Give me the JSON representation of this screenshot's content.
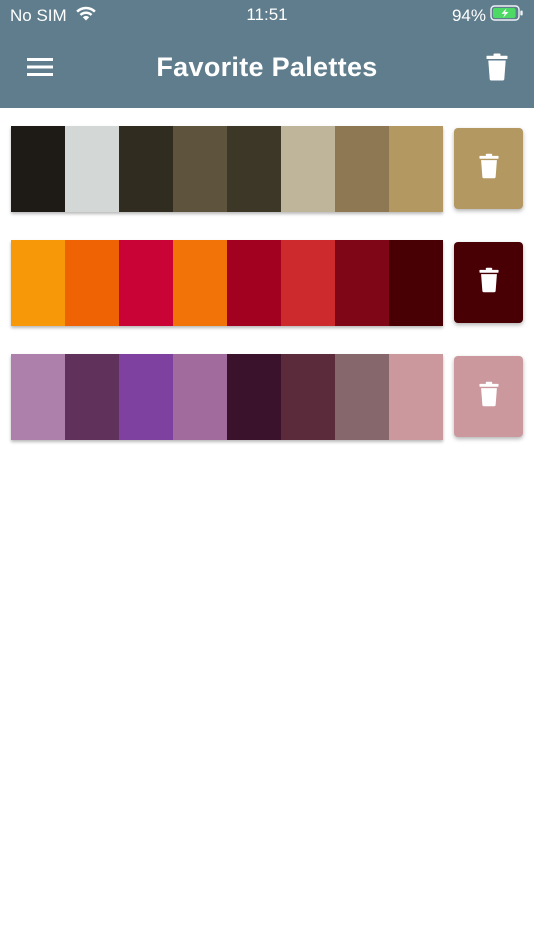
{
  "status_bar": {
    "carrier": "No SIM",
    "time": "11:51",
    "battery_percent": "94%",
    "battery_level": 0.94,
    "battery_charging": true
  },
  "header": {
    "title": "Favorite Palettes",
    "menu_icon": "hamburger-menu-icon",
    "delete_all_icon": "trash-icon",
    "background_color": "#5f7d8c"
  },
  "palettes": [
    {
      "colors": [
        "#1e1b16",
        "#d3d7d6",
        "#302d20",
        "#5e543d",
        "#3c3726",
        "#bfb59a",
        "#8d7853",
        "#b49861"
      ],
      "button_color": "#b49861",
      "button_icon": "trash-icon"
    },
    {
      "colors": [
        "#f79808",
        "#f06304",
        "#c90335",
        "#f27308",
        "#a20120",
        "#cc2a2c",
        "#7e0617",
        "#480005"
      ],
      "button_color": "#480005",
      "button_icon": "trash-icon"
    },
    {
      "colors": [
        "#ad80ac",
        "#60325b",
        "#7e41a0",
        "#a16b9e",
        "#3b122b",
        "#5b2a3b",
        "#86676c",
        "#cb989d"
      ],
      "button_color": "#cb989d",
      "button_icon": "trash-icon"
    }
  ]
}
